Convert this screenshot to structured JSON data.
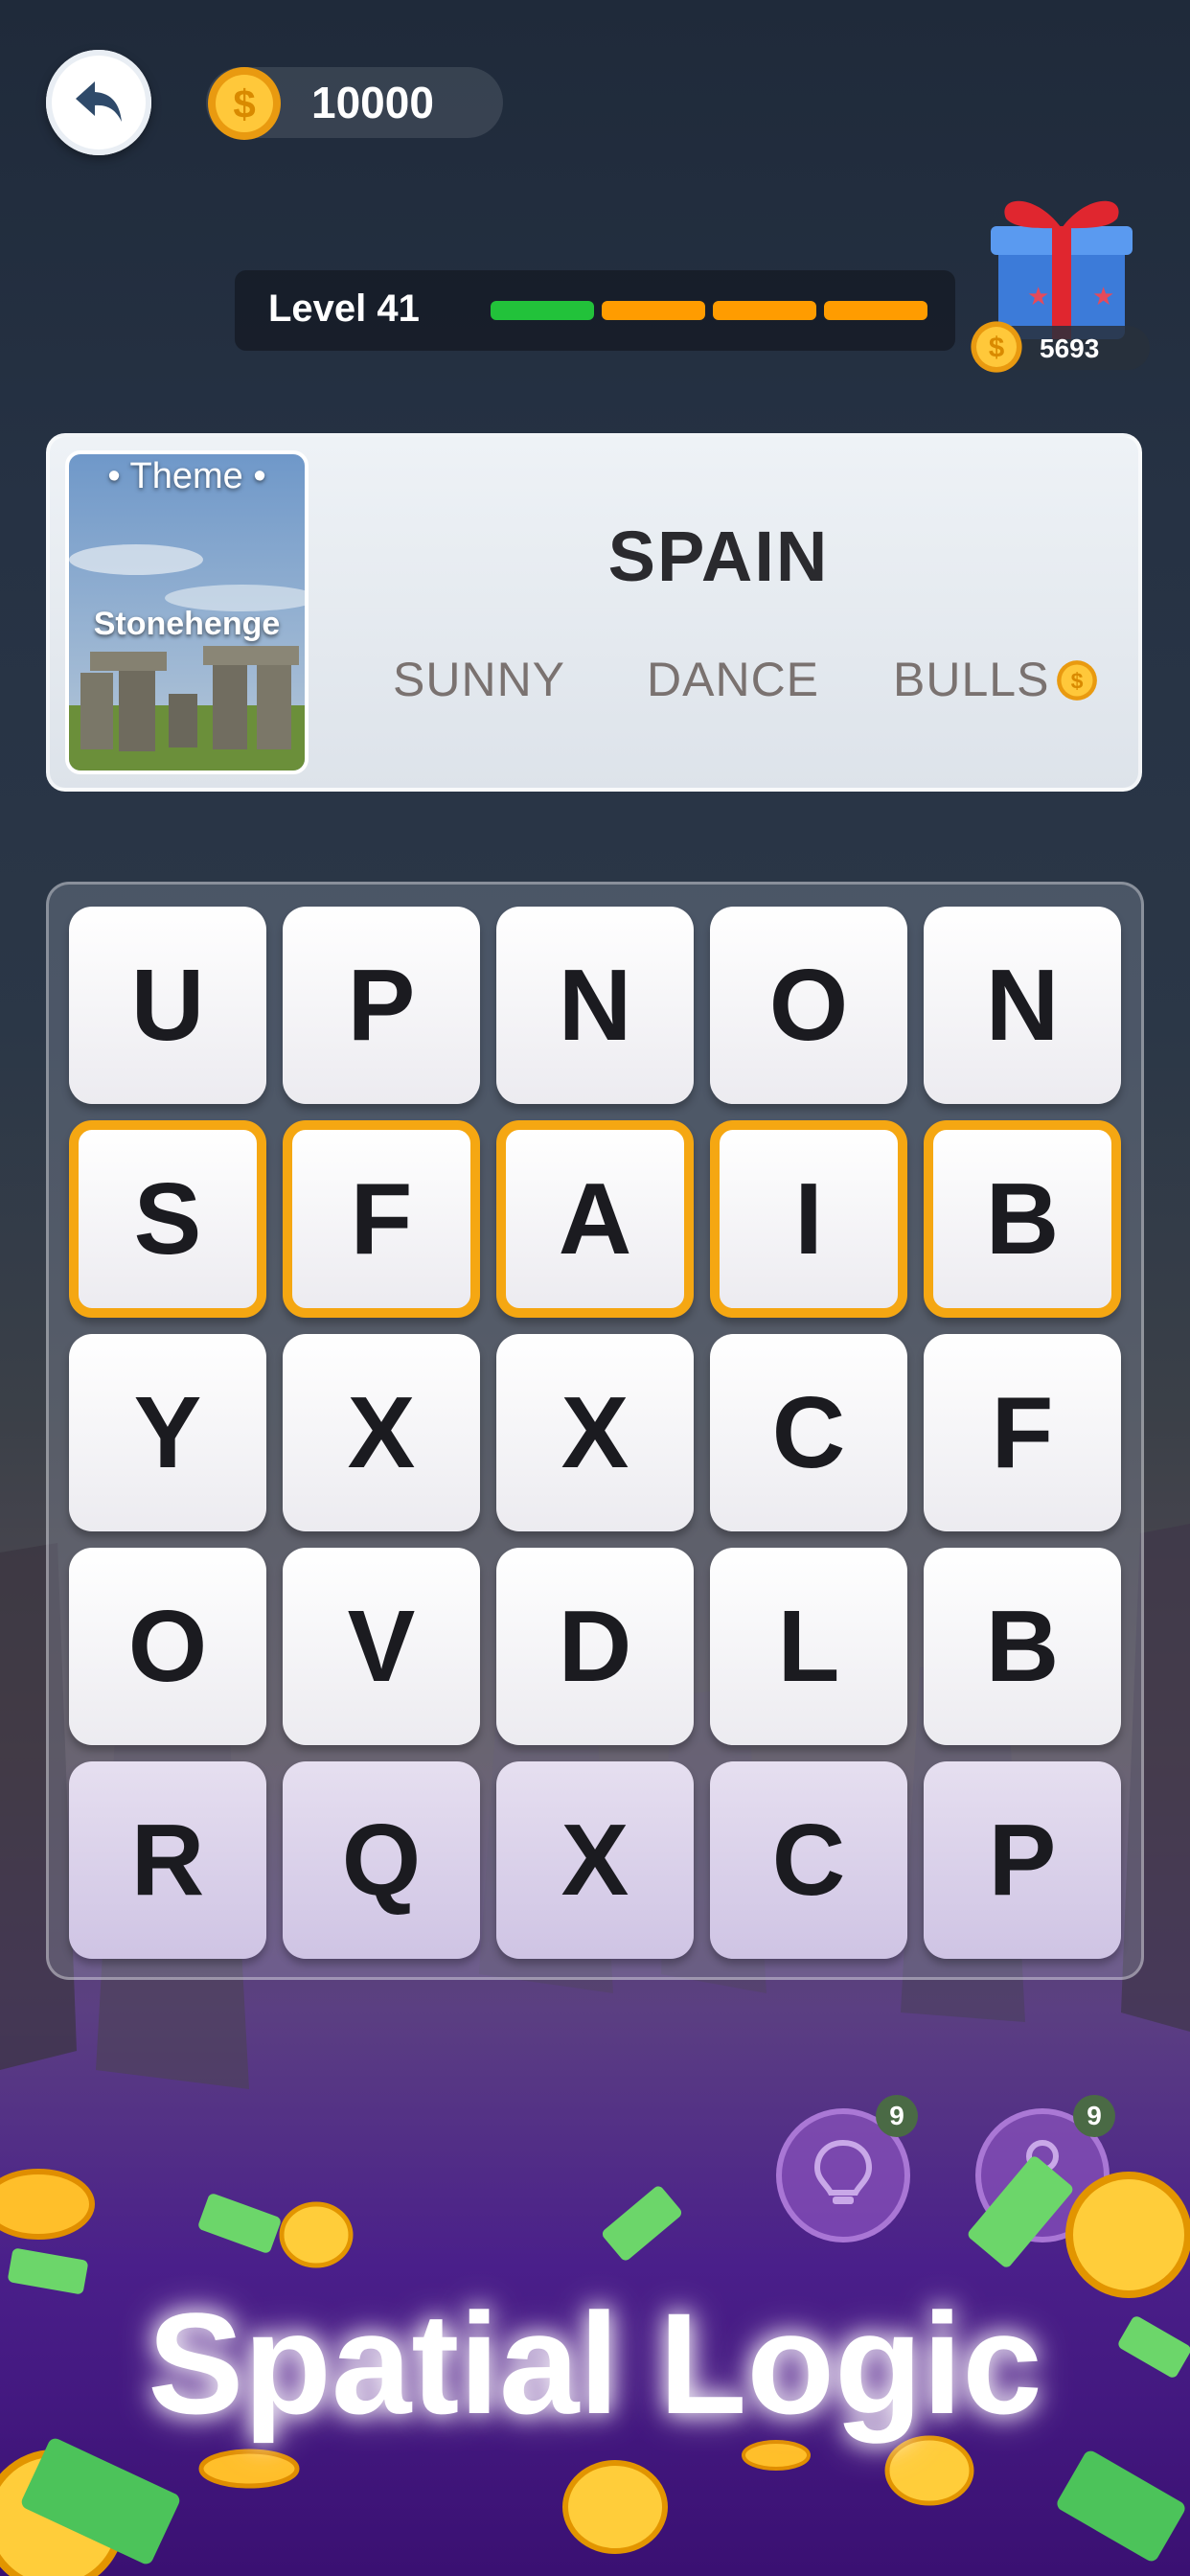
{
  "header": {
    "back_icon": "back-arrow-icon",
    "coins": "10000",
    "level_label": "Level 41",
    "level_progress": {
      "completed_segments": 1,
      "total_segments": 4
    },
    "gift_icon": "gift-box-icon",
    "gift_coins": "5693"
  },
  "theme": {
    "title": "Theme",
    "image_caption": "Stonehenge",
    "answer": "SPAIN",
    "words": [
      "SUNNY",
      "DANCE",
      "BULLS"
    ],
    "bonus_word_icon": "coin-icon"
  },
  "board": {
    "rows": [
      [
        "U",
        "P",
        "N",
        "O",
        "N"
      ],
      [
        "S",
        "F",
        "A",
        "I",
        "B"
      ],
      [
        "Y",
        "X",
        "X",
        "C",
        "F"
      ],
      [
        "O",
        "V",
        "D",
        "L",
        "B"
      ],
      [
        "R",
        "Q",
        "X",
        "C",
        "P"
      ]
    ],
    "selected_row": 1
  },
  "tools": {
    "hint_icon": "lightbulb-icon",
    "hint_count": "9",
    "key_icon": "key-icon",
    "key_count": "9"
  },
  "promo": {
    "title": "Spatial Logic"
  },
  "colors": {
    "accent": "#f5a712",
    "progress_done": "#22c23a",
    "progress_todo": "#ff9c00",
    "gift_red": "#e0262f",
    "gift_blue": "#3c7bd9"
  }
}
